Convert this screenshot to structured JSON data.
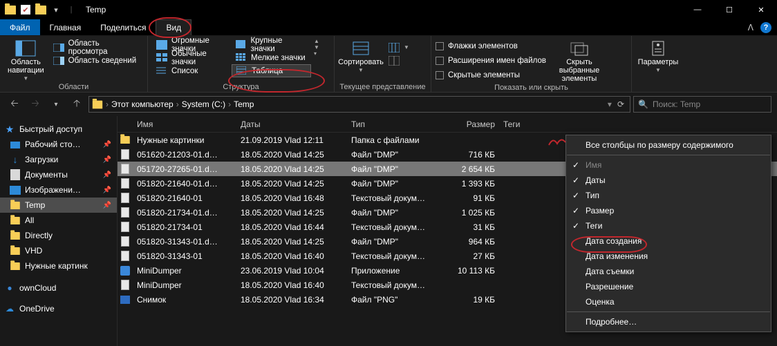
{
  "window": {
    "title": "Temp",
    "controls": {
      "min": "—",
      "max": "☐",
      "close": "✕"
    },
    "qat_dropdown": "▾",
    "qat_sep": "|"
  },
  "menu": {
    "file": "Файл",
    "home": "Главная",
    "share": "Поделиться",
    "view": "Вид",
    "collapse": "ᐱ",
    "help": "?"
  },
  "ribbon": {
    "panes": {
      "navpane": "Область навигации",
      "preview": "Область просмотра",
      "details_pane": "Область сведений",
      "group": "Области"
    },
    "layout": {
      "huge": "Огромные значки",
      "large": "Крупные значки",
      "medium": "Обычные значки",
      "small": "Мелкие значки",
      "list": "Список",
      "table": "Таблица",
      "group": "Структура"
    },
    "view": {
      "sort": "Сортировать",
      "group": "Текущее представление"
    },
    "showhide": {
      "checkboxes": "Флажки элементов",
      "extensions": "Расширения имен файлов",
      "hidden": "Скрытые элементы",
      "hide_selected": "Скрыть выбранные элементы",
      "group": "Показать или скрыть"
    },
    "options": {
      "label": "Параметры"
    }
  },
  "nav": {
    "back": "🡠",
    "fwd": "🡢",
    "up": "🡡",
    "recent": "▾",
    "refresh": "⟳",
    "crumb_dd": "▾",
    "crumbs": [
      "Этот компьютер",
      "System (C:)",
      "Temp"
    ],
    "sep": "›",
    "search_placeholder": "Поиск: Temp",
    "search_icon": "🔍"
  },
  "sidebar": {
    "quick": "Быстрый доступ",
    "items": [
      {
        "label": "Рабочий сто…",
        "pin": true
      },
      {
        "label": "Загрузки",
        "pin": true
      },
      {
        "label": "Документы",
        "pin": true
      },
      {
        "label": "Изображени…",
        "pin": true
      },
      {
        "label": "Temp",
        "pin": true,
        "sel": true
      },
      {
        "label": "All",
        "pin": false
      },
      {
        "label": "Directly",
        "pin": false
      },
      {
        "label": "VHD",
        "pin": false
      },
      {
        "label": "Нужные картинк",
        "pin": false
      }
    ],
    "owncloud": "ownCloud",
    "onedrive": "OneDrive"
  },
  "columns": {
    "name": "Имя",
    "date": "Даты",
    "type": "Тип",
    "size": "Размер",
    "tags": "Теги"
  },
  "files": [
    {
      "ico": "folder",
      "name": "Нужные картинки",
      "date": "21.09.2019 Vlad 12:11",
      "type": "Папка с файлами",
      "size": ""
    },
    {
      "ico": "doc",
      "name": "051620-21203-01.d…",
      "date": "18.05.2020 Vlad 14:25",
      "type": "Файл \"DMP\"",
      "size": "716 КБ"
    },
    {
      "ico": "doc",
      "name": "051720-27265-01.d…",
      "date": "18.05.2020 Vlad 14:25",
      "type": "Файл \"DMP\"",
      "size": "2 654 КБ",
      "sel": true
    },
    {
      "ico": "doc",
      "name": "051820-21640-01.d…",
      "date": "18.05.2020 Vlad 14:25",
      "type": "Файл \"DMP\"",
      "size": "1 393 КБ"
    },
    {
      "ico": "doc",
      "name": "051820-21640-01",
      "date": "18.05.2020 Vlad 16:48",
      "type": "Текстовый докум…",
      "size": "91 КБ"
    },
    {
      "ico": "doc",
      "name": "051820-21734-01.d…",
      "date": "18.05.2020 Vlad 14:25",
      "type": "Файл \"DMP\"",
      "size": "1 025 КБ"
    },
    {
      "ico": "doc",
      "name": "051820-21734-01",
      "date": "18.05.2020 Vlad 16:44",
      "type": "Текстовый докум…",
      "size": "31 КБ"
    },
    {
      "ico": "doc",
      "name": "051820-31343-01.d…",
      "date": "18.05.2020 Vlad 14:25",
      "type": "Файл \"DMP\"",
      "size": "964 КБ"
    },
    {
      "ico": "doc",
      "name": "051820-31343-01",
      "date": "18.05.2020 Vlad 16:40",
      "type": "Текстовый докум…",
      "size": "27 КБ"
    },
    {
      "ico": "exe",
      "name": "MiniDumper",
      "date": "23.06.2019 Vlad 10:04",
      "type": "Приложение",
      "size": "10 113 КБ"
    },
    {
      "ico": "doc",
      "name": "MiniDumper",
      "date": "18.05.2020 Vlad 16:40",
      "type": "Текстовый докум…",
      "size": ""
    },
    {
      "ico": "png",
      "name": "Снимок",
      "date": "18.05.2020 Vlad 16:34",
      "type": "Файл \"PNG\"",
      "size": "19 КБ"
    }
  ],
  "context_menu": {
    "fit_all": "Все столбцы по размеру содержимого",
    "items": [
      {
        "label": "Имя",
        "checked": true,
        "disabled": true
      },
      {
        "label": "Даты",
        "checked": true
      },
      {
        "label": "Тип",
        "checked": true
      },
      {
        "label": "Размер",
        "checked": true
      },
      {
        "label": "Теги",
        "checked": true
      },
      {
        "label": "Дата создания",
        "checked": false
      },
      {
        "label": "Дата изменения",
        "checked": false
      },
      {
        "label": "Дата съемки",
        "checked": false
      },
      {
        "label": "Разрешение",
        "checked": false
      },
      {
        "label": "Оценка",
        "checked": false
      }
    ],
    "more": "Подробнее…"
  }
}
